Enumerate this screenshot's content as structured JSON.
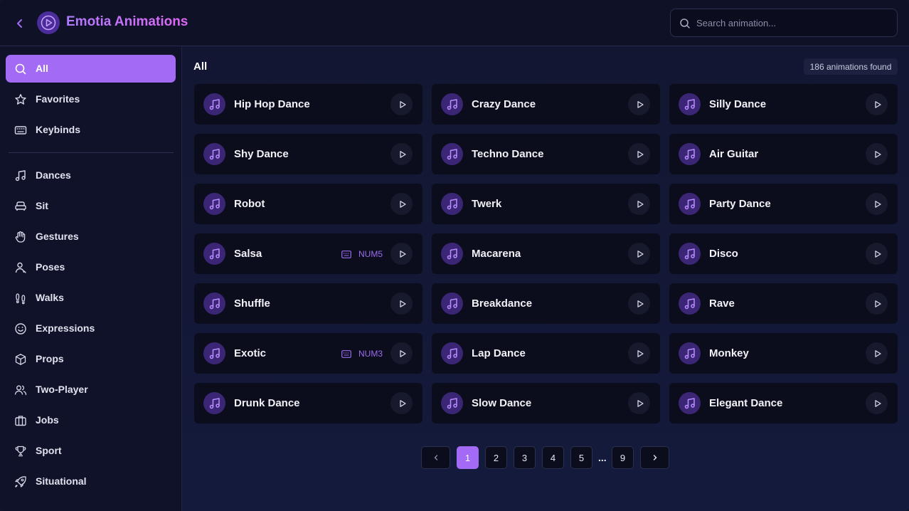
{
  "header": {
    "title": "Emotia Animations",
    "search_placeholder": "Search animation..."
  },
  "sidebar": {
    "items": [
      {
        "label": "All",
        "icon": "search-icon",
        "active": true
      },
      {
        "label": "Favorites",
        "icon": "star-icon"
      },
      {
        "label": "Keybinds",
        "icon": "keyboard-icon"
      },
      {
        "label": "Dances",
        "icon": "music-note-icon"
      },
      {
        "label": "Sit",
        "icon": "sofa-icon"
      },
      {
        "label": "Gestures",
        "icon": "hand-icon"
      },
      {
        "label": "Poses",
        "icon": "user-pose-icon"
      },
      {
        "label": "Walks",
        "icon": "footprints-icon"
      },
      {
        "label": "Expressions",
        "icon": "smile-icon"
      },
      {
        "label": "Props",
        "icon": "box-icon"
      },
      {
        "label": "Two-Player",
        "icon": "users-icon"
      },
      {
        "label": "Jobs",
        "icon": "briefcase-icon"
      },
      {
        "label": "Sport",
        "icon": "trophy-icon"
      },
      {
        "label": "Situational",
        "icon": "rocket-icon"
      }
    ]
  },
  "main": {
    "title": "All",
    "count_text": "186 animations found",
    "cards": [
      {
        "name": "Hip Hop Dance",
        "keybind": ""
      },
      {
        "name": "Crazy Dance",
        "keybind": ""
      },
      {
        "name": "Silly Dance",
        "keybind": ""
      },
      {
        "name": "Shy Dance",
        "keybind": ""
      },
      {
        "name": "Techno Dance",
        "keybind": ""
      },
      {
        "name": "Air Guitar",
        "keybind": ""
      },
      {
        "name": "Robot",
        "keybind": ""
      },
      {
        "name": "Twerk",
        "keybind": ""
      },
      {
        "name": "Party Dance",
        "keybind": ""
      },
      {
        "name": "Salsa",
        "keybind": "NUM5"
      },
      {
        "name": "Macarena",
        "keybind": ""
      },
      {
        "name": "Disco",
        "keybind": ""
      },
      {
        "name": "Shuffle",
        "keybind": ""
      },
      {
        "name": "Breakdance",
        "keybind": ""
      },
      {
        "name": "Rave",
        "keybind": ""
      },
      {
        "name": "Exotic",
        "keybind": "NUM3"
      },
      {
        "name": "Lap Dance",
        "keybind": ""
      },
      {
        "name": "Monkey",
        "keybind": ""
      },
      {
        "name": "Drunk Dance",
        "keybind": ""
      },
      {
        "name": "Slow Dance",
        "keybind": ""
      },
      {
        "name": "Elegant Dance",
        "keybind": ""
      }
    ]
  },
  "pagination": {
    "pages": [
      "1",
      "2",
      "3",
      "4",
      "5"
    ],
    "ellipsis": "...",
    "last": "9",
    "current": "1"
  },
  "colors": {
    "accent": "#a36bf5",
    "background": "#12152e",
    "card": "#0c0d1c",
    "title_gradient_start": "#b07bff",
    "title_gradient_end": "#e067f5"
  }
}
